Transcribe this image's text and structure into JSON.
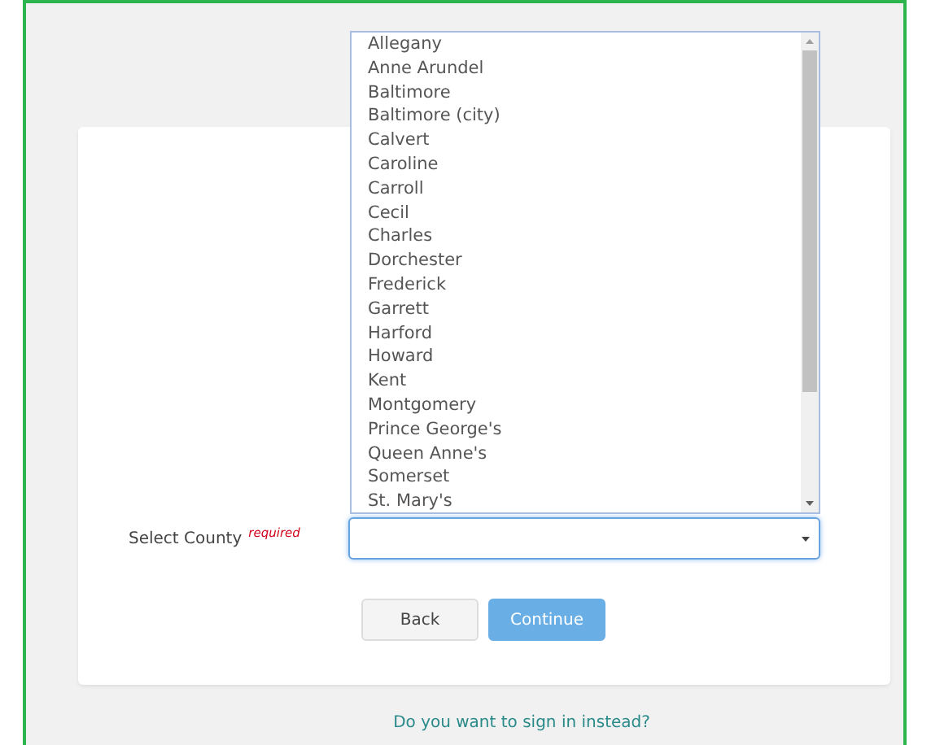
{
  "county_field": {
    "label": "Select County",
    "required_tag": "required",
    "expanded": true
  },
  "county_options": [
    {
      "label": "Allegany",
      "selected": false
    },
    {
      "label": "Anne Arundel",
      "selected": false
    },
    {
      "label": "Baltimore",
      "selected": false
    },
    {
      "label": "Baltimore (city)",
      "selected": false
    },
    {
      "label": "Calvert",
      "selected": false
    },
    {
      "label": "Caroline",
      "selected": false
    },
    {
      "label": "Carroll",
      "selected": false
    },
    {
      "label": "Cecil",
      "selected": false
    },
    {
      "label": "Charles",
      "selected": false
    },
    {
      "label": "Dorchester",
      "selected": false
    },
    {
      "label": "Frederick",
      "selected": false
    },
    {
      "label": "Garrett",
      "selected": false
    },
    {
      "label": "Harford",
      "selected": false
    },
    {
      "label": "Howard",
      "selected": false
    },
    {
      "label": "Kent",
      "selected": false
    },
    {
      "label": "Montgomery",
      "selected": false
    },
    {
      "label": "Prince George's",
      "selected": false
    },
    {
      "label": "Queen Anne's",
      "selected": false
    },
    {
      "label": "Somerset",
      "selected": false
    },
    {
      "label": "St. Mary's",
      "selected": false
    }
  ],
  "buttons": [
    {
      "label": "Back",
      "kind": "secondary",
      "disabled": false
    },
    {
      "label": "Continue",
      "kind": "primary",
      "disabled": true
    }
  ],
  "signin_link": "Do you want to sign in instead?"
}
